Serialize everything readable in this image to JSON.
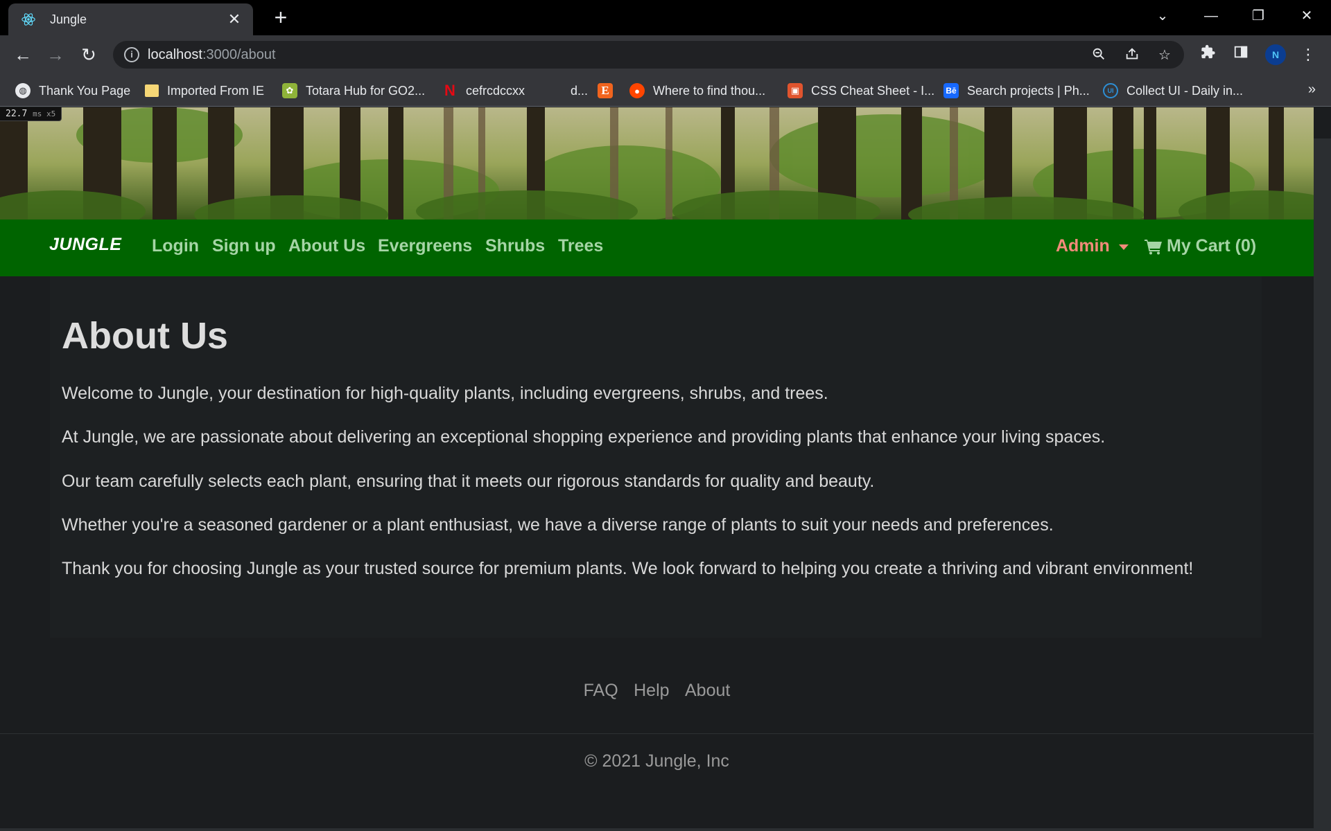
{
  "browser": {
    "tab_title": "Jungle",
    "url_host": "localhost",
    "url_rest": ":3000/about",
    "profile_initial": "N",
    "bookmarks": [
      {
        "label": "Thank You Page",
        "icon": "globe-icon"
      },
      {
        "label": "Imported From IE",
        "icon": "folder-icon"
      },
      {
        "label": "Totara Hub for GO2...",
        "icon": "totara-icon"
      },
      {
        "label": "cefrcdccxx",
        "icon": "netflix-icon"
      },
      {
        "label": "d...",
        "icon": "blank-icon"
      },
      {
        "label": "",
        "icon": "etsy-icon"
      },
      {
        "label": "Where to find thou...",
        "icon": "reddit-icon"
      },
      {
        "label": "CSS Cheat Sheet - I...",
        "icon": "gift-icon"
      },
      {
        "label": "Search projects | Ph...",
        "icon": "behance-icon"
      },
      {
        "label": "Collect UI - Daily in...",
        "icon": "collectui-icon"
      }
    ]
  },
  "perf": {
    "value": "22.7",
    "unit": "ms x5"
  },
  "nav": {
    "brand": "JUNGLE",
    "links": [
      "Login",
      "Sign up",
      "About Us",
      "Evergreens",
      "Shrubs",
      "Trees"
    ],
    "admin": "Admin",
    "cart": "My Cart (0)"
  },
  "content": {
    "title": "About Us",
    "paragraphs": [
      "Welcome to Jungle, your destination for high-quality plants, including evergreens, shrubs, and trees.",
      "At Jungle, we are passionate about delivering an exceptional shopping experience and providing plants that enhance your living spaces.",
      "Our team carefully selects each plant, ensuring that it meets our rigorous standards for quality and beauty.",
      "Whether you're a seasoned gardener or a plant enthusiast, we have a diverse range of plants to suit your needs and preferences.",
      "Thank you for choosing Jungle as your trusted source for premium plants. We look forward to helping you create a thriving and vibrant environment!"
    ]
  },
  "footer": {
    "links": [
      "FAQ",
      "Help",
      "About"
    ],
    "copyright": "© 2021 Jungle, Inc"
  },
  "colors": {
    "navbar": "#006400",
    "nav_link": "#a6d5a6",
    "admin": "#f28b7a",
    "page_bg": "#1b1d1f"
  }
}
